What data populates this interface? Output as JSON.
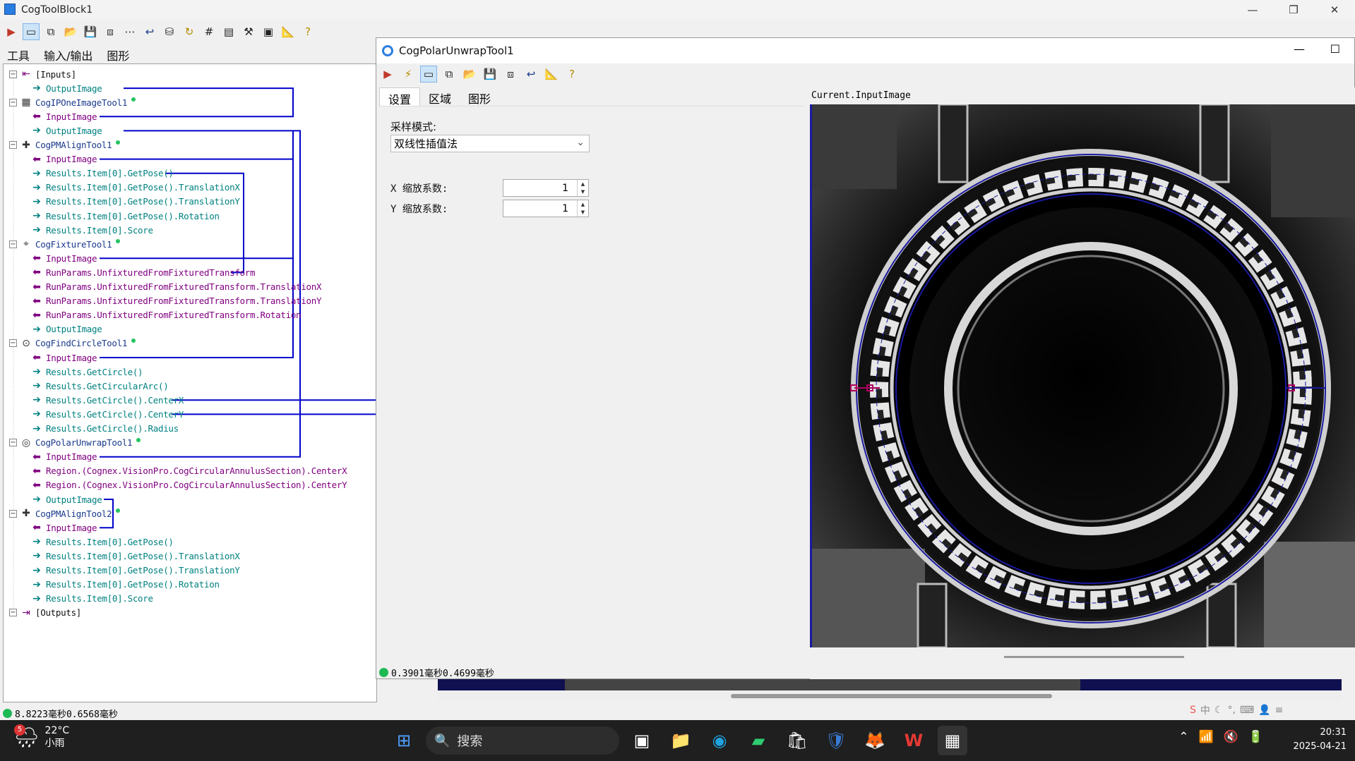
{
  "main_window": {
    "title": "CogToolBlock1",
    "tabs": [
      "工具",
      "输入/输出",
      "图形"
    ],
    "status_time": "8.8223毫秒0.6568毫秒"
  },
  "tree": [
    {
      "kind": "group",
      "label": "[Inputs]",
      "icon": "input-arrow-icon"
    },
    {
      "kind": "out",
      "label": "OutputImage"
    },
    {
      "kind": "tool",
      "label": "CogIPOneImageTool1",
      "icon": "image-process-icon"
    },
    {
      "kind": "in",
      "label": "InputImage"
    },
    {
      "kind": "out",
      "label": "OutputImage"
    },
    {
      "kind": "tool",
      "label": "CogPMAlignTool1",
      "icon": "pattern-align-icon"
    },
    {
      "kind": "in",
      "label": "InputImage"
    },
    {
      "kind": "out",
      "label": "Results.Item[0].GetPose()"
    },
    {
      "kind": "out",
      "label": "Results.Item[0].GetPose().TranslationX"
    },
    {
      "kind": "out",
      "label": "Results.Item[0].GetPose().TranslationY"
    },
    {
      "kind": "out",
      "label": "Results.Item[0].GetPose().Rotation"
    },
    {
      "kind": "out",
      "label": "Results.Item[0].Score"
    },
    {
      "kind": "tool",
      "label": "CogFixtureTool1",
      "icon": "fixture-icon"
    },
    {
      "kind": "in",
      "label": "InputImage"
    },
    {
      "kind": "in",
      "label": "RunParams.UnfixturedFromFixturedTransform"
    },
    {
      "kind": "in",
      "label": "RunParams.UnfixturedFromFixturedTransform.TranslationX"
    },
    {
      "kind": "in",
      "label": "RunParams.UnfixturedFromFixturedTransform.TranslationY"
    },
    {
      "kind": "in",
      "label": "RunParams.UnfixturedFromFixturedTransform.Rotation"
    },
    {
      "kind": "out",
      "label": "OutputImage"
    },
    {
      "kind": "tool",
      "label": "CogFindCircleTool1",
      "icon": "find-circle-icon"
    },
    {
      "kind": "in",
      "label": "InputImage"
    },
    {
      "kind": "out",
      "label": "Results.GetCircle()"
    },
    {
      "kind": "out",
      "label": "Results.GetCircularArc()"
    },
    {
      "kind": "out",
      "label": "Results.GetCircle().CenterX"
    },
    {
      "kind": "out",
      "label": "Results.GetCircle().CenterY"
    },
    {
      "kind": "out",
      "label": "Results.GetCircle().Radius"
    },
    {
      "kind": "tool",
      "label": "CogPolarUnwrapTool1",
      "icon": "polar-unwrap-icon"
    },
    {
      "kind": "in",
      "label": "InputImage"
    },
    {
      "kind": "in",
      "label": "Region.(Cognex.VisionPro.CogCircularAnnulusSection).CenterX"
    },
    {
      "kind": "in",
      "label": "Region.(Cognex.VisionPro.CogCircularAnnulusSection).CenterY"
    },
    {
      "kind": "out",
      "label": "OutputImage"
    },
    {
      "kind": "tool",
      "label": "CogPMAlignTool2",
      "icon": "pattern-align-icon"
    },
    {
      "kind": "in",
      "label": "InputImage"
    },
    {
      "kind": "out",
      "label": "Results.Item[0].GetPose()"
    },
    {
      "kind": "out",
      "label": "Results.Item[0].GetPose().TranslationX"
    },
    {
      "kind": "out",
      "label": "Results.Item[0].GetPose().TranslationY"
    },
    {
      "kind": "out",
      "label": "Results.Item[0].GetPose().Rotation"
    },
    {
      "kind": "out",
      "label": "Results.Item[0].Score"
    },
    {
      "kind": "group",
      "label": "[Outputs]",
      "icon": "output-arrow-icon"
    }
  ],
  "polar_window": {
    "title": "CogPolarUnwrapTool1",
    "tabs": [
      "设置",
      "区域",
      "图形"
    ],
    "sampling_mode_label": "采样模式:",
    "sampling_mode_value": "双线性插值法",
    "x_scale_label": "X 缩放系数:",
    "x_scale_value": "1",
    "y_scale_label": "Y 缩放系数:",
    "y_scale_value": "1",
    "image_label": "Current.InputImage",
    "status_time": "0.3901毫秒0.4699毫秒"
  },
  "taskbar": {
    "weather_temp": "22°C",
    "weather_desc": "小雨",
    "weather_badge": "5",
    "search_placeholder": "搜索",
    "time": "20:31",
    "date": "2025-04-21"
  },
  "colors": {
    "connector": "#0000cc",
    "in_arrow": "#800080",
    "out_arrow": "#008080",
    "accent_title": "#1a1aa0"
  }
}
